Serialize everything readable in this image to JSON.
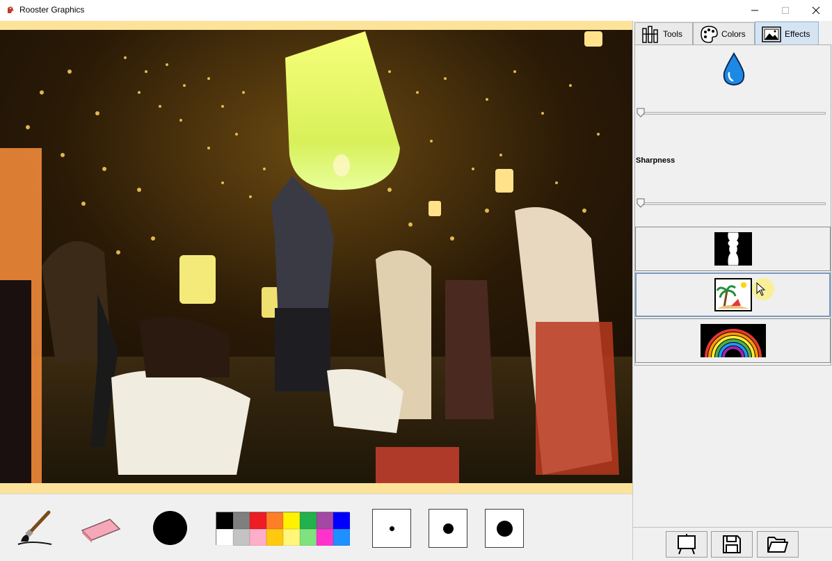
{
  "window": {
    "title": "Rooster Graphics",
    "minimize_icon": "minimize-icon",
    "maximize_icon": "maximize-icon",
    "close_icon": "close-icon"
  },
  "tabs": [
    {
      "label": "Tools",
      "icon": "tools-icon"
    },
    {
      "label": "Colors",
      "icon": "palette-icon"
    },
    {
      "label": "Effects",
      "icon": "picture-icon",
      "active": true
    }
  ],
  "effects_panel": {
    "blur_icon": "water-drop-icon",
    "blur_level": 0,
    "sharpness_label": "Sharpness",
    "sharpness_level": 0,
    "effect_buttons": [
      {
        "icon": "silhouette-faces-icon"
      },
      {
        "icon": "beach-scene-icon"
      },
      {
        "icon": "rainbow-icon"
      }
    ]
  },
  "toolbar": {
    "tools": [
      "paintbrush-icon",
      "eraser-icon",
      "current-color-icon"
    ],
    "current_color": "#000000",
    "palette": [
      "#000000",
      "#7f7f7f",
      "#ee1c24",
      "#ff7f27",
      "#fff200",
      "#22b14c",
      "#a349a4",
      "#0000ff",
      "#ffffff",
      "#c3c3c3",
      "#ffaec9",
      "#ffc90e",
      "#fff67a",
      "#7fe27f",
      "#ff33cc",
      "#1e90ff"
    ],
    "brush_sizes": [
      "small",
      "medium",
      "large"
    ]
  },
  "footer": [
    "canvas-icon",
    "save-icon",
    "open-folder-icon"
  ],
  "accent_color": "#d5e4f3"
}
